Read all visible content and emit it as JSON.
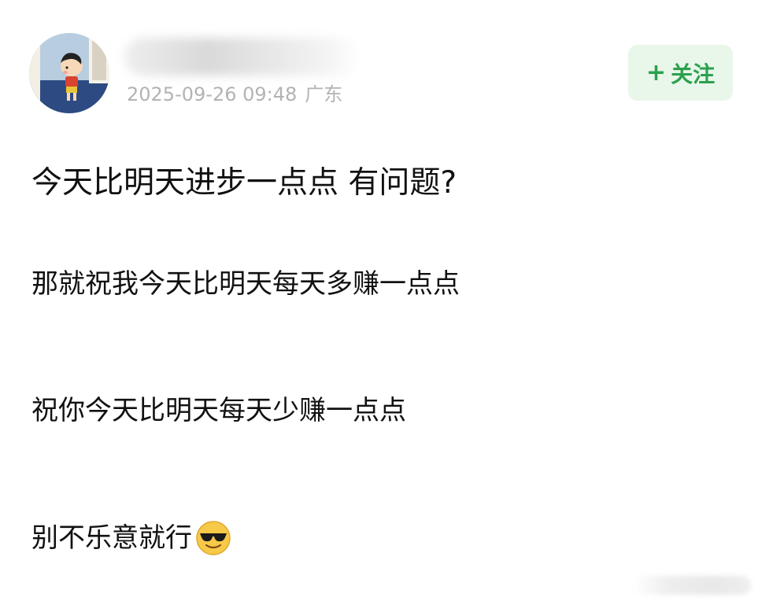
{
  "post": {
    "author": {
      "name": "",
      "avatar_icon": "cartoon-boy-avatar"
    },
    "meta": {
      "timestamp": "2025-09-26 09:48",
      "location": "广东"
    },
    "follow_button": {
      "icon": "+",
      "label": "关注",
      "text_color": "#2aa14e",
      "bg_color": "#e9f6ea"
    },
    "content": {
      "line1": "今天比明天进步一点点 有问题?",
      "line2": "那就祝我今天比明天每天多赚一点点",
      "line3": "祝你今天比明天每天少赚一点点",
      "line4": "别不乐意就行",
      "line4_emoji": "sunglasses-emoji"
    }
  }
}
